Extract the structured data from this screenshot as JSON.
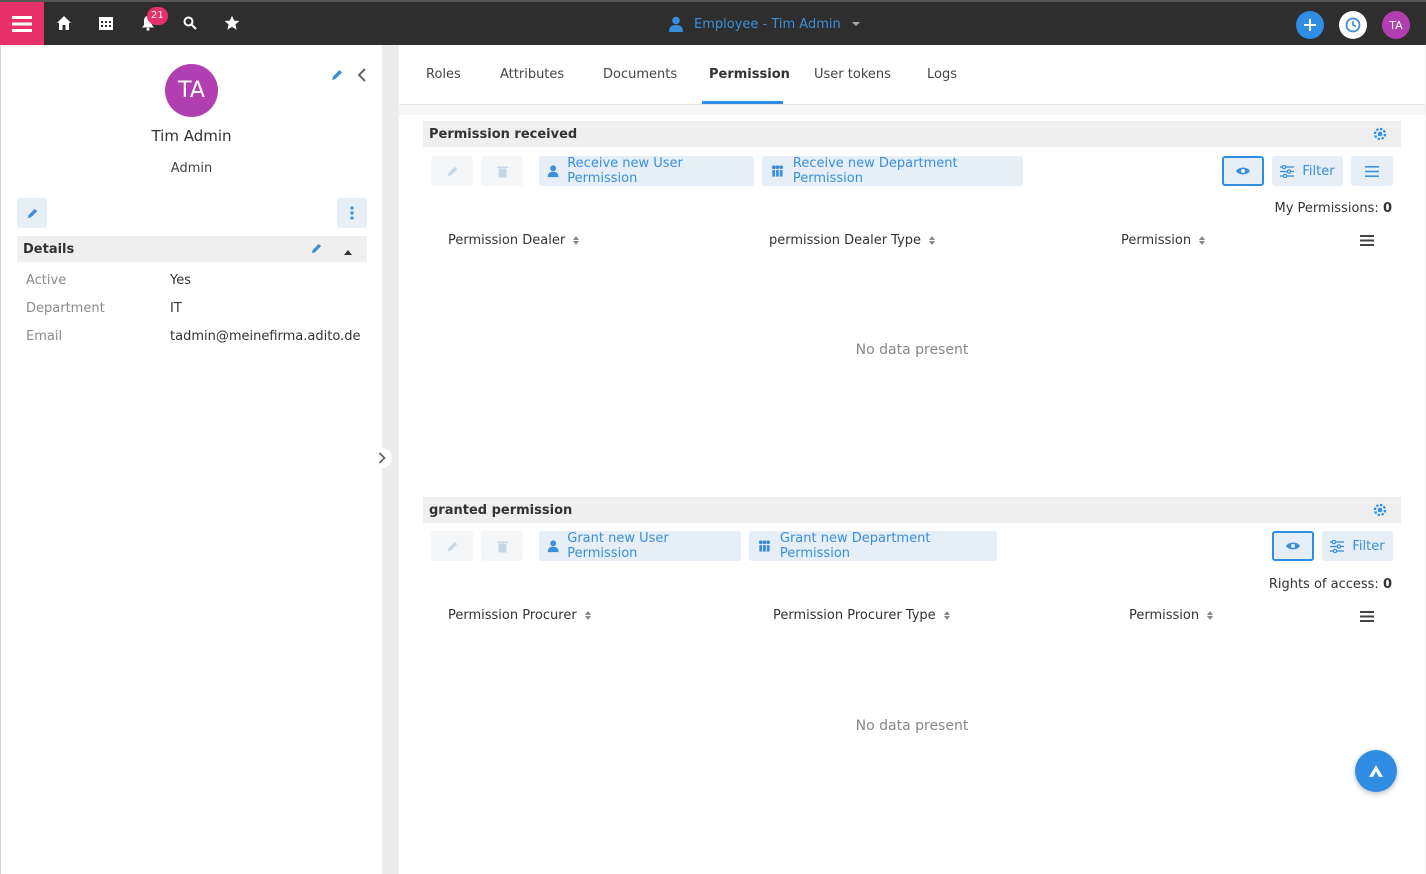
{
  "topbar": {
    "notifications_count": "21",
    "context_label": "Employee - Tim Admin",
    "user_initials": "TA",
    "accent": "#e8306a"
  },
  "profile": {
    "initials": "TA",
    "name": "Tim Admin",
    "role": "Admin"
  },
  "details": {
    "title": "Details",
    "rows": [
      {
        "label": "Active",
        "value": "Yes"
      },
      {
        "label": "Department",
        "value": "IT"
      },
      {
        "label": "Email",
        "value": "tadmin@meinefirma.adito.de"
      }
    ]
  },
  "tabs": [
    "Roles",
    "Attributes",
    "Documents",
    "Permission",
    "User tokens",
    "Logs"
  ],
  "active_tab": "Permission",
  "received": {
    "title": "Permission received",
    "btn_user": "Receive new User Permission",
    "btn_dept": "Receive new Department Permission",
    "filter": "Filter",
    "count_label": "My Permissions:",
    "count_value": "0",
    "columns": [
      "Permission Dealer",
      "permission Dealer Type",
      "Permission"
    ],
    "empty": "No data present"
  },
  "granted": {
    "title": "granted permission",
    "btn_user": "Grant new User Permission",
    "btn_dept": "Grant new Department Permission",
    "filter": "Filter",
    "count_label": "Rights of access:",
    "count_value": "0",
    "columns": [
      "Permission Procurer",
      "Permission Procurer Type",
      "Permission"
    ],
    "empty": "No data present"
  }
}
